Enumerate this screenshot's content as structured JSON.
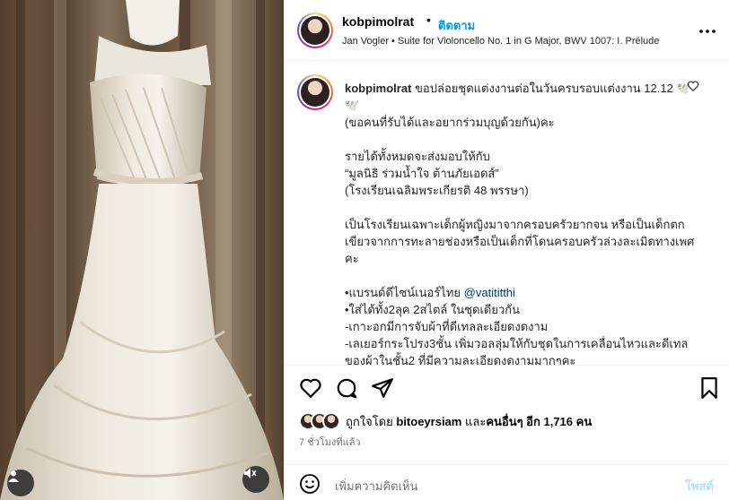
{
  "header": {
    "username": "kobpimolrat",
    "dot": "•",
    "follow": "ติดตาม",
    "audio": "Jan Vogler • Suite for Violoncello No. 1 in G Major, BWV 1007: I. Prélude"
  },
  "caption": {
    "username": "kobpimolrat",
    "first_line": "ขอปล่อยชุดแต่งงานต่อในวันครบรอบแต่งงาน 12.12 🕊️🕊️",
    "lines": [
      "(ขอคนที่รับได้และอยากร่วมบุญด้วยกัน)คะ",
      "",
      "รายได้ทั้งหมดจะส่งมอบให้กับ",
      "“มูลนิธิ ร่วมน้ำใจ ต้านภัยเอดส์”",
      "(โรงเรียนเฉลิมพระเกียรติ 48 พรรษา)",
      "",
      "เป็นโรงเรียนเฉพาะเด็กผู้หญิงมาจากครอบครัวยากจน หรือเป็นเด็กตกเขียวจากการทะลายช่องหรือเป็นเด็กที่โดนครอบครัวล่วงละเมิดทางเพศคะ",
      "",
      "•แบรนด์ดีไซน์เนอร์ไทย",
      "•ใส่ได้ทั้ง2ลุค 2สไตล์ ในชุดเดียวกัน",
      "-เกาะอกมีการจับผ้าที่ดีเทลละเอียดงดงาม",
      "-เลเยอร์กระโปรง3ชั้น เพิ่มวอลลุ่มให้กับชุดในการเคลื่อนไหวและดีเทลของผ้าในชั้น2 ที่มีความละเอียดงดงามมากๆคะ"
    ],
    "mention": "@vatititthi"
  },
  "likes": {
    "prefix": "ถูกใจโดย",
    "user": "bitoeyrsiam",
    "middle": "และ",
    "others": "คนอื่นๆ อีก 1,716 คน"
  },
  "time": "7 ชั่วโมงที่แล้ว",
  "comment": {
    "placeholder": "เพิ่มความคิดเห็น",
    "post": "โพสต์"
  },
  "icons": {
    "like": "heart-icon",
    "comment": "comment-icon",
    "share": "paper-plane-icon",
    "save": "bookmark-icon",
    "more": "more-dots-icon",
    "emoji": "emoji-icon",
    "mute": "speaker-muted-icon",
    "tag": "user-tag-icon"
  },
  "colors": {
    "accent": "#0095f6",
    "mention": "#00376b",
    "secondary_text": "#737373"
  }
}
